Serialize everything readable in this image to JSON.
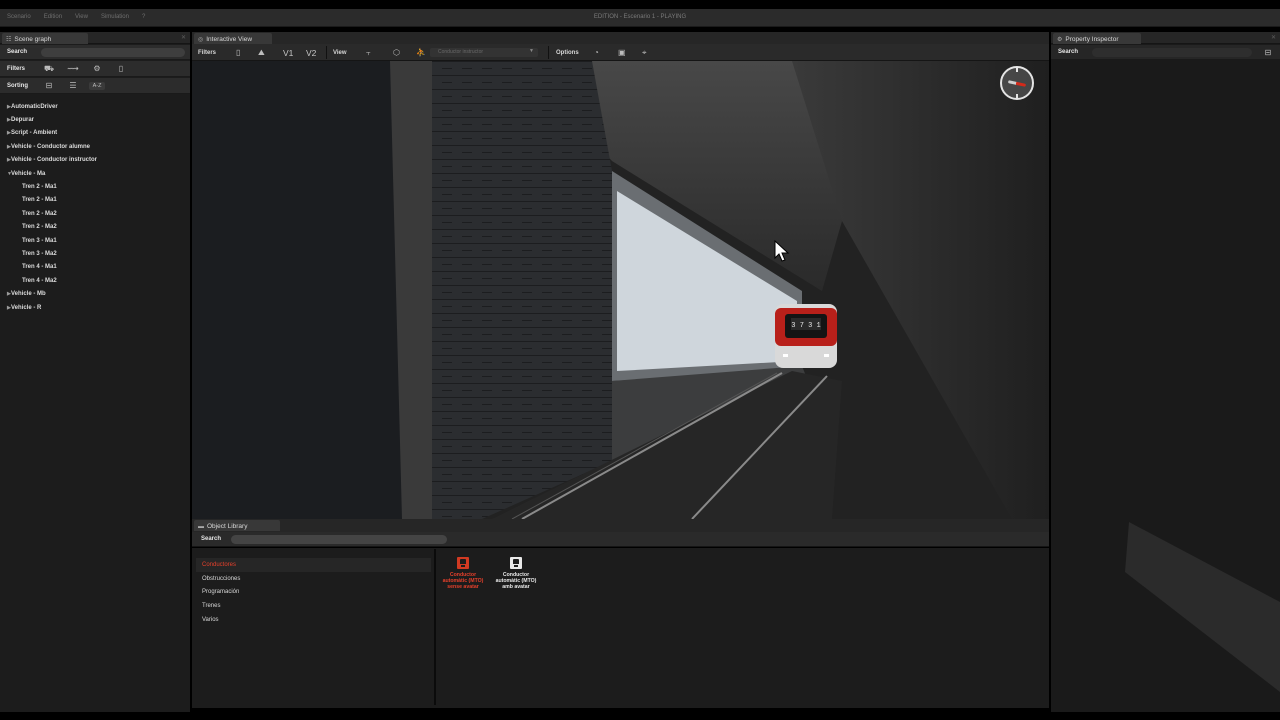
{
  "window": {
    "title": "EDITION - Escenario 1 - PLAYING",
    "menu": [
      "Scenario",
      "Edition",
      "View",
      "Simulation",
      "?"
    ]
  },
  "scene_graph": {
    "tab": "Scene graph",
    "search_label": "Search",
    "filters_label": "Filters",
    "sorting_label": "Sorting",
    "sort_alpha": "A-Z",
    "tree": [
      {
        "label": "AutomaticDriver",
        "expanded": false
      },
      {
        "label": "Depurar",
        "expanded": false
      },
      {
        "label": "Script - Ambient",
        "expanded": false
      },
      {
        "label": "Vehicle - Conductor alumne",
        "expanded": false
      },
      {
        "label": "Vehicle - Conductor instructor",
        "expanded": false
      },
      {
        "label": "Vehicle - Ma",
        "expanded": true
      },
      {
        "label": "Tren 2 - Ma1",
        "child": true
      },
      {
        "label": "Tren 2 - Ma1",
        "child": true
      },
      {
        "label": "Tren 2 - Ma2",
        "child": true
      },
      {
        "label": "Tren 2 - Ma2",
        "child": true
      },
      {
        "label": "Tren 3 - Ma1",
        "child": true
      },
      {
        "label": "Tren 3 - Ma2",
        "child": true
      },
      {
        "label": "Tren 4 - Ma1",
        "child": true
      },
      {
        "label": "Tren 4 - Ma2",
        "child": true
      },
      {
        "label": "Vehicle - Mb",
        "expanded": false
      },
      {
        "label": "Vehicle - R",
        "expanded": false
      }
    ]
  },
  "interactive_view": {
    "tab": "Interactive View",
    "filters_label": "Filters",
    "v1": "V1",
    "v2": "V2",
    "view_label": "View",
    "camera_dropdown": "Conductor instructor",
    "options_label": "Options"
  },
  "property_inspector": {
    "tab": "Property Inspector",
    "search_label": "Search"
  },
  "object_library": {
    "tab": "Object Library",
    "search_label": "Search",
    "categories": [
      {
        "label": "Conductores",
        "selected": true
      },
      {
        "label": "Obstrucciones",
        "selected": false
      },
      {
        "label": "Programación",
        "selected": false
      },
      {
        "label": "Trenes",
        "selected": false
      },
      {
        "label": "Varios",
        "selected": false
      }
    ],
    "items": [
      {
        "label": "Conductor automàtic (MTO) sense avatar",
        "color": "#e5402b",
        "icon": "driver-icon"
      },
      {
        "label": "Conductor automàtic (MTO) amb avatar",
        "color": "#e8e8e8",
        "icon": "driver-icon"
      }
    ]
  },
  "train": {
    "destination_display": "3 7 3 1"
  },
  "colors": {
    "accent_red": "#e5402b",
    "panel_bg": "#1c1c1c",
    "toolbar_bg": "#2a2a2a"
  }
}
